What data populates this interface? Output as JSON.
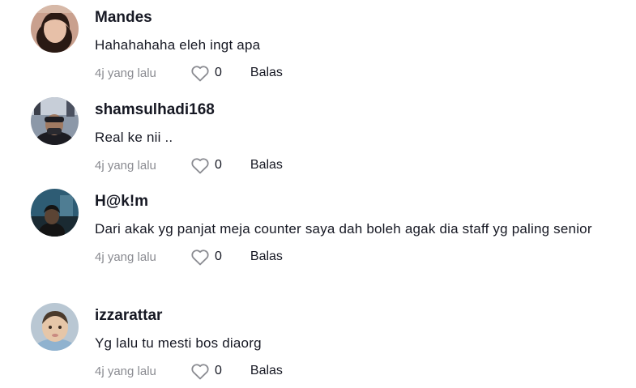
{
  "comments": [
    {
      "username": "Mandes",
      "text": "Hahahahaha eleh ingt apa",
      "time": "4j yang lalu",
      "likes": "0",
      "reply_label": "Balas",
      "avatar_colors": {
        "bg": "#c9a08e",
        "face": "#e7c0a8",
        "hair": "#2a1a14"
      }
    },
    {
      "username": "shamsulhadi168",
      "text": "Real ke nii ..",
      "time": "4j yang lalu",
      "likes": "0",
      "reply_label": "Balas",
      "avatar_colors": {
        "bg": "#8c98a8",
        "face": "#a07a62",
        "hair": "#1c1c22"
      }
    },
    {
      "username": "H@k!m",
      "text": "Dari akak yg panjat meja counter saya dah boleh agak dia staff yg paling senior",
      "time": "4j yang lalu",
      "likes": "0",
      "reply_label": "Balas",
      "avatar_colors": {
        "bg": "#2e5c74",
        "face": "#5b4434",
        "hair": "#141414"
      }
    },
    {
      "username": "izzarattar",
      "text": "Yg lalu tu mesti bos diaorg",
      "time": "4j yang lalu",
      "likes": "0",
      "reply_label": "Balas",
      "avatar_colors": {
        "bg": "#b9c7d3",
        "face": "#e6c6a8",
        "hair": "#4a3a2c"
      }
    }
  ]
}
